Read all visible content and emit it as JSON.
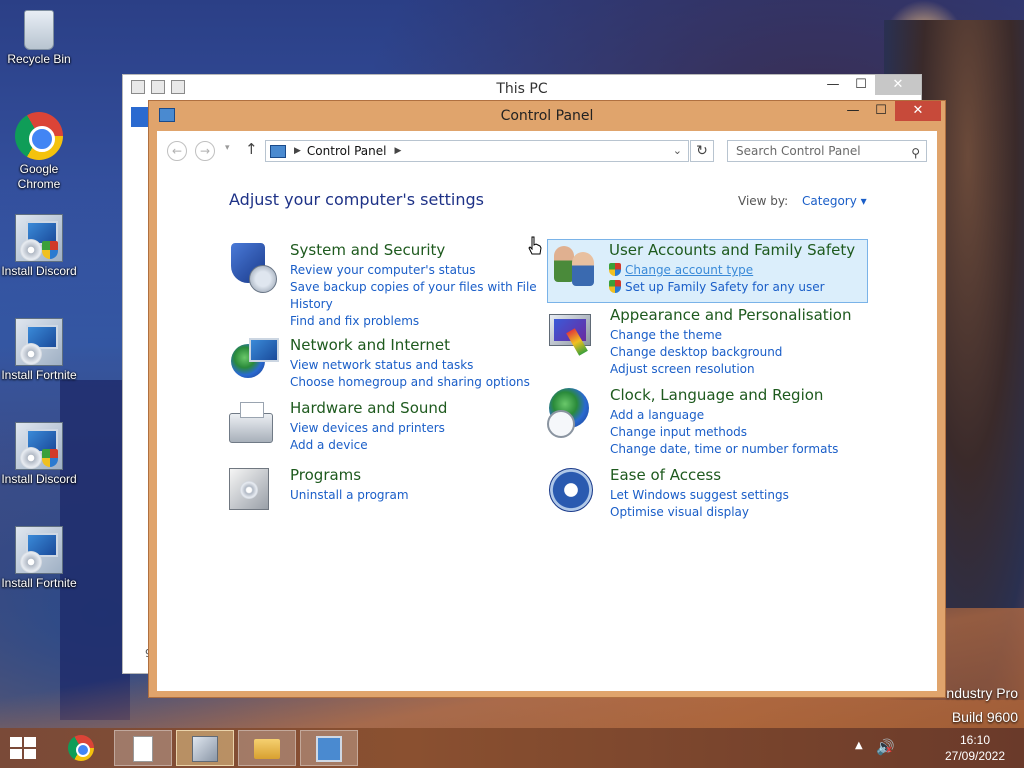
{
  "desktop": {
    "icons": [
      {
        "label": "Recycle Bin",
        "icon": "recycle-bin-icon"
      },
      {
        "label": "Google Chrome",
        "icon": "chrome-icon"
      },
      {
        "label": "Install Discord",
        "icon": "setup-icon"
      },
      {
        "label": "Install Fortnite",
        "icon": "setup-icon"
      },
      {
        "label": "Install Discord",
        "icon": "setup-icon"
      },
      {
        "label": "Install Fortnite",
        "icon": "setup-icon"
      }
    ],
    "watermark_line1": "ndustry Pro",
    "watermark_line2": "Build 9600"
  },
  "this_pc": {
    "title": "This PC",
    "minimize": "—",
    "maximize": "☐",
    "close": "✕",
    "peek_text": "9"
  },
  "control_panel": {
    "title": "Control Panel",
    "minimize": "—",
    "maximize": "☐",
    "close": "✕",
    "nav": {
      "back": "←",
      "forward": "→",
      "recent": "▾",
      "up": "↑",
      "breadcrumb": "Control Panel",
      "sep": "▶",
      "refresh": "↻",
      "search_placeholder": "Search Control Panel"
    },
    "heading": "Adjust your computer's settings",
    "view_by_label": "View by:",
    "view_by_value": "Category",
    "categories": [
      {
        "title": "System and Security",
        "icon": "security-shield-icon",
        "links": [
          "Review your computer's status",
          "Save backup copies of your files with File History",
          "Find and fix problems"
        ]
      },
      {
        "title": "Network and Internet",
        "icon": "network-globe-icon",
        "links": [
          "View network status and tasks",
          "Choose homegroup and sharing options"
        ]
      },
      {
        "title": "Hardware and Sound",
        "icon": "printer-icon",
        "links": [
          "View devices and printers",
          "Add a device"
        ]
      },
      {
        "title": "Programs",
        "icon": "programs-box-icon",
        "links": [
          "Uninstall a program"
        ]
      },
      {
        "title": "User Accounts and Family Safety",
        "icon": "users-icon",
        "links": [
          "Change account type",
          "Set up Family Safety for any user"
        ]
      },
      {
        "title": "Appearance and Personalisation",
        "icon": "monitor-paint-icon",
        "links": [
          "Change the theme",
          "Change desktop background",
          "Adjust screen resolution"
        ]
      },
      {
        "title": "Clock, Language and Region",
        "icon": "clock-globe-icon",
        "links": [
          "Add a language",
          "Change input methods",
          "Change date, time or number formats"
        ]
      },
      {
        "title": "Ease of Access",
        "icon": "ease-of-access-icon",
        "links": [
          "Let Windows suggest settings",
          "Optimise visual display"
        ]
      }
    ]
  },
  "taskbar": {
    "items": [
      "chrome-icon",
      "notepad-icon",
      "setup-icon",
      "file-explorer-icon",
      "control-panel-icon"
    ],
    "tray_up": "▲",
    "volume": "🔊",
    "volume_muted": "x",
    "time": "16:10",
    "date": "27/09/2022"
  },
  "colors": {
    "accent_link": "#1a5ec8",
    "category_title": "#1e5a1e",
    "heading": "#1e3287",
    "window_frame": "#e0a46c",
    "close_button": "#c74a3a"
  }
}
